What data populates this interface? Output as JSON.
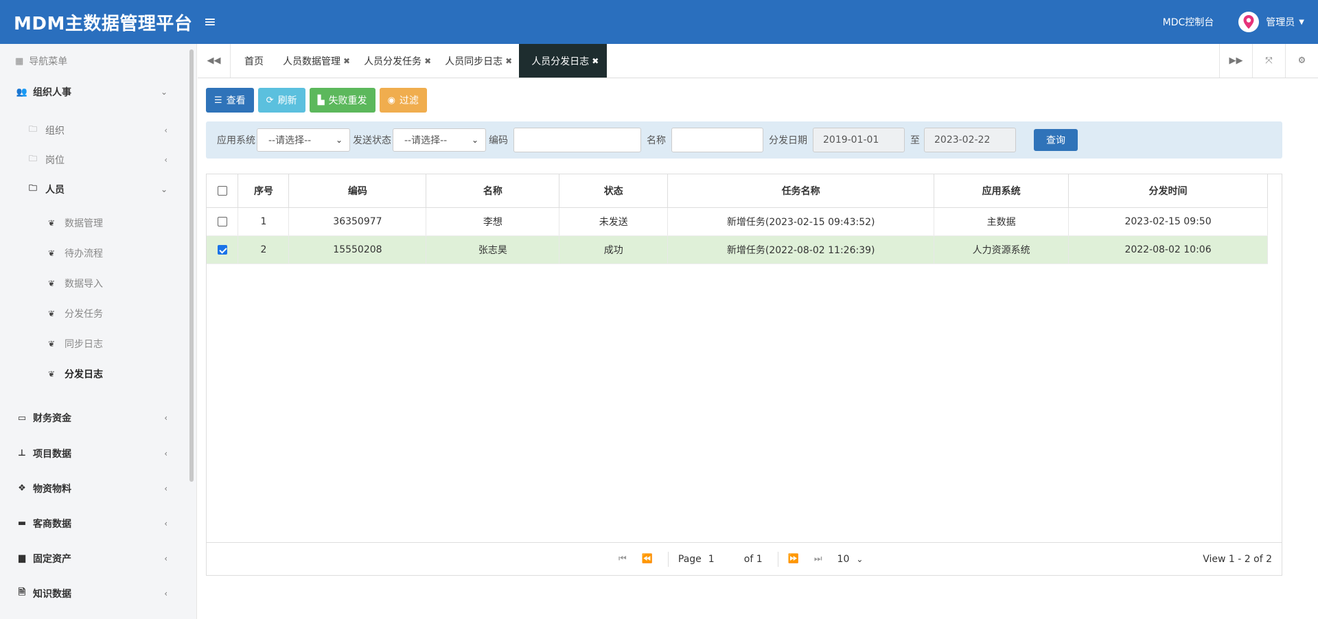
{
  "header": {
    "title": "MDM主数据管理平台",
    "menu_icon": "hamburger-icon",
    "console_link": "MDC控制台",
    "user_name": "管理员"
  },
  "sidebar": {
    "header": "导航菜单",
    "groups": [
      {
        "label": "组织人事"
      },
      {
        "label": "财务资金"
      },
      {
        "label": "项目数据"
      },
      {
        "label": "物资物料"
      },
      {
        "label": "客商数据"
      },
      {
        "label": "固定资产"
      },
      {
        "label": "知识数据"
      }
    ],
    "sub": [
      {
        "label": "组织"
      },
      {
        "label": "岗位"
      },
      {
        "label": "人员"
      }
    ],
    "leaves": [
      {
        "label": "数据管理"
      },
      {
        "label": "待办流程"
      },
      {
        "label": "数据导入"
      },
      {
        "label": "分发任务"
      },
      {
        "label": "同步日志"
      },
      {
        "label": "分发日志"
      }
    ]
  },
  "tabs": [
    {
      "label": "首页"
    },
    {
      "label": "人员数据管理"
    },
    {
      "label": "人员分发任务"
    },
    {
      "label": "人员同步日志"
    },
    {
      "label": "人员分发日志"
    }
  ],
  "toolbar": {
    "view": "查看",
    "refresh": "刷新",
    "resend": "失败重发",
    "filter": "过滤"
  },
  "filter": {
    "app_system_label": "应用系统",
    "app_system_value": "--请选择--",
    "send_status_label": "发送状态",
    "send_status_value": "--请选择--",
    "code_label": "编码",
    "code_value": "",
    "name_label": "名称",
    "name_value": "",
    "date_label": "分发日期",
    "date_from": "2019-01-01",
    "date_to_label": "至",
    "date_to": "2023-02-22",
    "query": "查询"
  },
  "table": {
    "columns": [
      "序号",
      "编码",
      "名称",
      "状态",
      "任务名称",
      "应用系统",
      "分发时间"
    ],
    "rows": [
      {
        "no": "1",
        "code": "36350977",
        "name": "李想",
        "status": "未发送",
        "task": "新增任务(2023-02-15 09:43:52)",
        "system": "主数据",
        "time": "2023-02-15 09:50",
        "checked": false
      },
      {
        "no": "2",
        "code": "15550208",
        "name": "张志昊",
        "status": "成功",
        "task": "新增任务(2022-08-02 11:26:39)",
        "system": "人力资源系统",
        "time": "2022-08-02 10:06",
        "checked": true
      }
    ]
  },
  "pager": {
    "page_label": "Page",
    "page_value": "1",
    "of_label": "of 1",
    "page_size": "10",
    "view_info": "View 1 - 2 of 2"
  },
  "colors": {
    "header_bg": "#2a6fbe",
    "active_tab_bg": "#1e2d2f",
    "selected_row_bg": "#dff0d8"
  }
}
